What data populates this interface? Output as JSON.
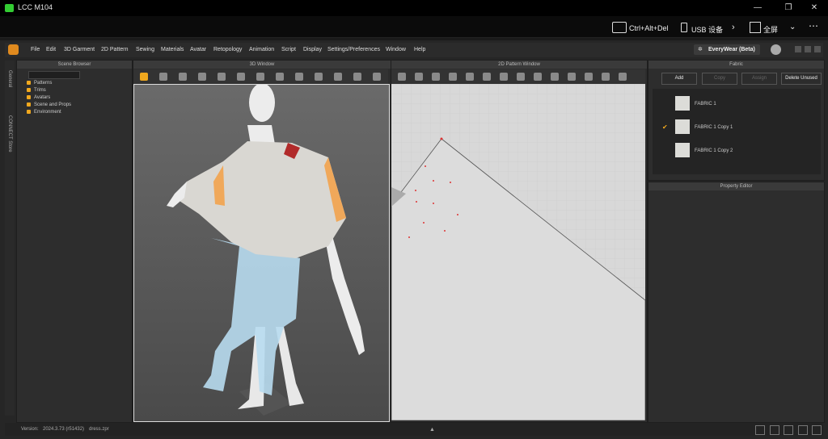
{
  "remote": {
    "title": "LCC M104",
    "ctrl_alt_del": "Ctrl+Alt+Del",
    "usb": "USB 设备",
    "fullscreen": "全屏"
  },
  "menu": [
    "File",
    "Edit",
    "3D Garment",
    "2D Pattern",
    "Sewing",
    "Materials",
    "Avatar",
    "Retopology",
    "Animation",
    "Script",
    "Display",
    "Settings/Preferences",
    "Window",
    "Help"
  ],
  "everywear": "EveryWear (Beta)",
  "sidetabs": [
    "General",
    "CONNECT Store"
  ],
  "scene_browser": {
    "title": "Scene Browser",
    "items": [
      "Patterns",
      "Trims",
      "Avatars",
      "Scene and Props",
      "Environment"
    ]
  },
  "window3d": {
    "title": "3D Window"
  },
  "window2d": {
    "title": "2D Pattern Window"
  },
  "fabric": {
    "title": "Fabric",
    "buttons": [
      "Add",
      "Copy",
      "Assign",
      "Delete Unused"
    ],
    "items": [
      {
        "name": "FABRIC 1",
        "checked": false
      },
      {
        "name": "FABRIC 1 Copy 1",
        "checked": true
      },
      {
        "name": "FABRIC 1 Copy 2",
        "checked": false
      }
    ]
  },
  "property_editor": {
    "title": "Property Editor"
  },
  "status": {
    "version_label": "Version:",
    "version": "2024.3.73 (r51432)",
    "file": "dress.zpr"
  },
  "colors": {
    "accent": "#f0a81e",
    "panel": "#2d2d2d",
    "viewport2d": "#d8d8d8"
  }
}
